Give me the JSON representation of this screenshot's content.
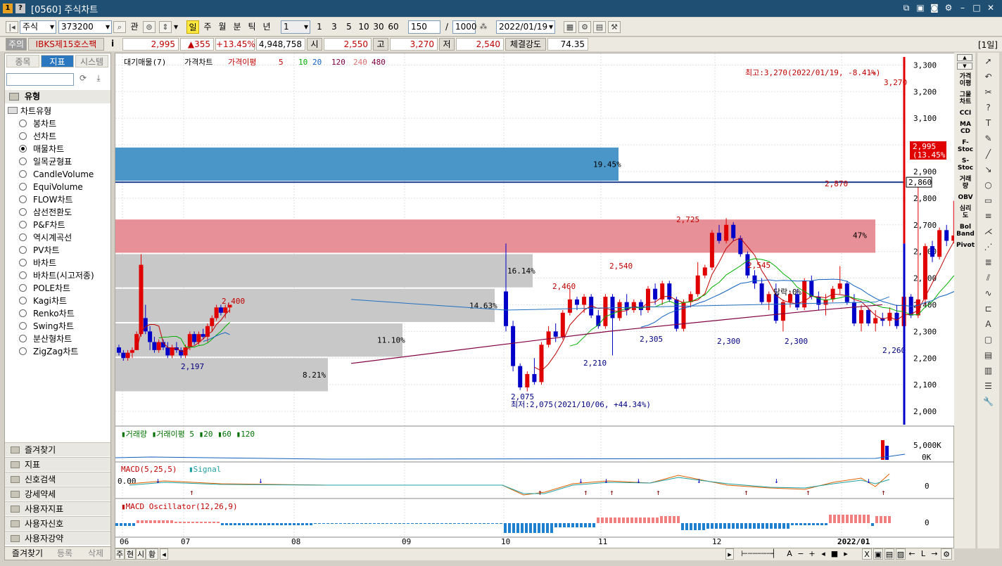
{
  "window": {
    "badge1": "1",
    "badge2": "?",
    "title": "[0560] 주식차트"
  },
  "toolbar": {
    "market": "주식",
    "code": "373200",
    "btn_gwan": "관",
    "periods": [
      "일",
      "주",
      "월",
      "분",
      "틱",
      "년"
    ],
    "selected_period": "일",
    "unit": "1",
    "intervals": [
      "1",
      "3",
      "5",
      "10",
      "30",
      "60"
    ],
    "count": "150",
    "slash": "/",
    "total": "1000",
    "date": "2022/01/19"
  },
  "quote": {
    "warn": "주의",
    "name": "IBKS제15호스팩",
    "info": "i",
    "price": "2,995",
    "change": "▲355",
    "rate": "+13.45%",
    "volume": "4,948,758",
    "open_label": "시",
    "open": "2,550",
    "high_label": "고",
    "high": "3,270",
    "low_label": "저",
    "low": "2,540",
    "strength_label": "체결강도",
    "strength": "74.35",
    "period_badge": "[1일]"
  },
  "left": {
    "tabs": [
      "종목",
      "지표",
      "시스템"
    ],
    "selected_tab": "지표",
    "section": "유형",
    "group": "차트유형",
    "types": [
      "봉차트",
      "선차트",
      "매물차트",
      "일목균형표",
      "CandleVolume",
      "EquiVolume",
      "FLOW차트",
      "삼선전환도",
      "P&F차트",
      "역시계곡선",
      "PV차트",
      "바차트",
      "바차트(시고저종)",
      "POLE차트",
      "Kagi차트",
      "Renko차트",
      "Swing차트",
      "분산형차트",
      "ZigZag차트"
    ],
    "selected_type": "매물차트",
    "folders": [
      "즐겨찾기",
      "지표",
      "신호검색",
      "강세약세",
      "사용자지표",
      "사용자신호",
      "사용자강약"
    ],
    "bottom": [
      "즐겨찾기",
      "등록",
      "삭제"
    ]
  },
  "chart_data": {
    "type": "candlestick",
    "legend": {
      "items": [
        "대기매물(7)",
        "가격차트",
        "가격이평",
        "5",
        "10",
        "20",
        "120",
        "240",
        "480"
      ]
    },
    "y_ticks": [
      "3,300",
      "3,200",
      "3,100",
      "3,000",
      "2,900",
      "2,800",
      "2,700",
      "2,600",
      "2,500",
      "2,400",
      "2,300",
      "2,200",
      "2,100",
      "2,000"
    ],
    "x_ticks": [
      "06",
      "07",
      "08",
      "09",
      "10",
      "11",
      "12",
      "2022/01"
    ],
    "annotations": {
      "max": "최고:3,270(2022/01/19, -8.41%)",
      "min": "최저:2,075(2021/10/06, +44.34%)",
      "today": "당락:0%",
      "labels": [
        "3,270",
        "2,870",
        "2,725",
        "2,545",
        "2,540",
        "2,460",
        "2,400",
        "2,305",
        "2,300",
        "2,300",
        "2,260",
        "2,210",
        "2,197",
        "2,075"
      ]
    },
    "current_price": "2,995",
    "current_rate": "(13.45%)",
    "line_price": "2,860",
    "volume_profile": [
      {
        "pct": "19.45%",
        "from": 2860,
        "to": 2990,
        "color": "#4a96c8"
      },
      {
        "pct": "",
        "from": 2590,
        "to": 2720,
        "color": "#e89098"
      },
      {
        "pct": "16.14%",
        "from": 2460,
        "to": 2590,
        "color": "#c8c8c8"
      },
      {
        "pct": "14.63%",
        "from": 2330,
        "to": 2460,
        "color": "#c8c8c8"
      },
      {
        "pct": "11.10%",
        "from": 2200,
        "to": 2330,
        "color": "#c8c8c8"
      },
      {
        "pct": "8.21%",
        "from": 2070,
        "to": 2200,
        "color": "#c8c8c8"
      },
      {
        "pct": "47%",
        "from": 2590,
        "to": 2720,
        "color": "#e89098"
      }
    ],
    "candles": [
      [
        2240,
        2250,
        2210,
        2220
      ],
      [
        2220,
        2230,
        2190,
        2200
      ],
      [
        2200,
        2230,
        2190,
        2220
      ],
      [
        2220,
        2240,
        2200,
        2230
      ],
      [
        2230,
        2300,
        2230,
        2290
      ],
      [
        2290,
        2590,
        2280,
        2550
      ],
      [
        2350,
        2400,
        2290,
        2300
      ],
      [
        2300,
        2320,
        2230,
        2260
      ],
      [
        2260,
        2280,
        2220,
        2230
      ],
      [
        2230,
        2270,
        2220,
        2260
      ],
      [
        2260,
        2270,
        2230,
        2240
      ],
      [
        2240,
        2260,
        2200,
        2210
      ],
      [
        2210,
        2250,
        2200,
        2240
      ],
      [
        2240,
        2260,
        2220,
        2230
      ],
      [
        2230,
        2240,
        2200,
        2210
      ],
      [
        2210,
        2250,
        2200,
        2240
      ],
      [
        2240,
        2300,
        2230,
        2290
      ],
      [
        2290,
        2300,
        2250,
        2260
      ],
      [
        2260,
        2300,
        2250,
        2290
      ],
      [
        2290,
        2310,
        2270,
        2280
      ],
      [
        2280,
        2330,
        2260,
        2320
      ],
      [
        2320,
        2360,
        2300,
        2350
      ],
      [
        2350,
        2400,
        2340,
        2390
      ],
      [
        2390,
        2400,
        2360,
        2370
      ],
      [
        2370,
        2400,
        2350,
        2390
      ],
      [
        2390,
        2400,
        2370,
        2400
      ]
    ],
    "candles2": [
      [
        2450,
        2630,
        2300,
        2320
      ],
      [
        2320,
        2340,
        2150,
        2170
      ],
      [
        2170,
        2180,
        2080,
        2090
      ],
      [
        2090,
        2150,
        2075,
        2140
      ],
      [
        2140,
        2200,
        2100,
        2110
      ],
      [
        2110,
        2260,
        2100,
        2250
      ],
      [
        2250,
        2320,
        2240,
        2300
      ],
      [
        2300,
        2330,
        2260,
        2280
      ],
      [
        2280,
        2380,
        2270,
        2370
      ],
      [
        2370,
        2460,
        2360,
        2420
      ],
      [
        2420,
        2430,
        2380,
        2400
      ],
      [
        2400,
        2440,
        2370,
        2430
      ],
      [
        2430,
        2440,
        2350,
        2360
      ],
      [
        2360,
        2380,
        2310,
        2320
      ],
      [
        2320,
        2440,
        2310,
        2430
      ],
      [
        2430,
        2440,
        2210,
        2350
      ],
      [
        2350,
        2420,
        2340,
        2410
      ],
      [
        2410,
        2440,
        2360,
        2380
      ],
      [
        2380,
        2420,
        2370,
        2410
      ],
      [
        2410,
        2420,
        2360,
        2380
      ],
      [
        2380,
        2470,
        2370,
        2460
      ],
      [
        2460,
        2480,
        2400,
        2420
      ],
      [
        2420,
        2490,
        2400,
        2480
      ],
      [
        2480,
        2490,
        2410,
        2420
      ],
      [
        2420,
        2430,
        2300,
        2310
      ],
      [
        2310,
        2420,
        2300,
        2410
      ],
      [
        2410,
        2450,
        2390,
        2440
      ],
      [
        2440,
        2560,
        2430,
        2510
      ],
      [
        2510,
        2550,
        2500,
        2540
      ],
      [
        2540,
        2680,
        2530,
        2670
      ],
      [
        2670,
        2700,
        2630,
        2640
      ],
      [
        2640,
        2725,
        2630,
        2700
      ],
      [
        2700,
        2710,
        2640,
        2650
      ],
      [
        2650,
        2660,
        2580,
        2590
      ],
      [
        2590,
        2600,
        2500,
        2510
      ],
      [
        2510,
        2530,
        2460,
        2480
      ],
      [
        2480,
        2500,
        2400,
        2410
      ],
      [
        2410,
        2450,
        2380,
        2440
      ],
      [
        2440,
        2480,
        2330,
        2340
      ],
      [
        2340,
        2420,
        2300,
        2410
      ],
      [
        2410,
        2450,
        2390,
        2440
      ],
      [
        2440,
        2460,
        2380,
        2390
      ],
      [
        2390,
        2500,
        2380,
        2490
      ],
      [
        2490,
        2510,
        2420,
        2430
      ],
      [
        2430,
        2450,
        2380,
        2400
      ],
      [
        2400,
        2440,
        2360,
        2420
      ],
      [
        2420,
        2470,
        2410,
        2460
      ],
      [
        2460,
        2545,
        2440,
        2480
      ],
      [
        2480,
        2490,
        2400,
        2410
      ],
      [
        2410,
        2440,
        2320,
        2330
      ],
      [
        2330,
        2400,
        2300,
        2380
      ],
      [
        2380,
        2390,
        2320,
        2330
      ],
      [
        2330,
        2380,
        2300,
        2350
      ],
      [
        2350,
        2370,
        2320,
        2340
      ],
      [
        2340,
        2390,
        2320,
        2370
      ],
      [
        2370,
        2400,
        2310,
        2320
      ],
      [
        2320,
        2450,
        2310,
        2430
      ],
      [
        2430,
        2440,
        2350,
        2360
      ],
      [
        2360,
        2870,
        2350,
        2420
      ],
      [
        2420,
        2630,
        2400,
        2620
      ],
      [
        2620,
        2640,
        2560,
        2580
      ],
      [
        2580,
        2690,
        2570,
        2680
      ],
      [
        2680,
        2700,
        2620,
        2640
      ],
      [
        2640,
        2790,
        2630,
        2660
      ],
      [
        2660,
        2670,
        2530,
        2540
      ],
      [
        2540,
        2560,
        2400,
        2420
      ],
      [
        2420,
        2430,
        2340,
        2360
      ],
      [
        2360,
        2370,
        2300,
        2310
      ],
      [
        2310,
        2320,
        2260,
        2290
      ],
      [
        2550,
        3270,
        2540,
        2995
      ]
    ]
  }
}
